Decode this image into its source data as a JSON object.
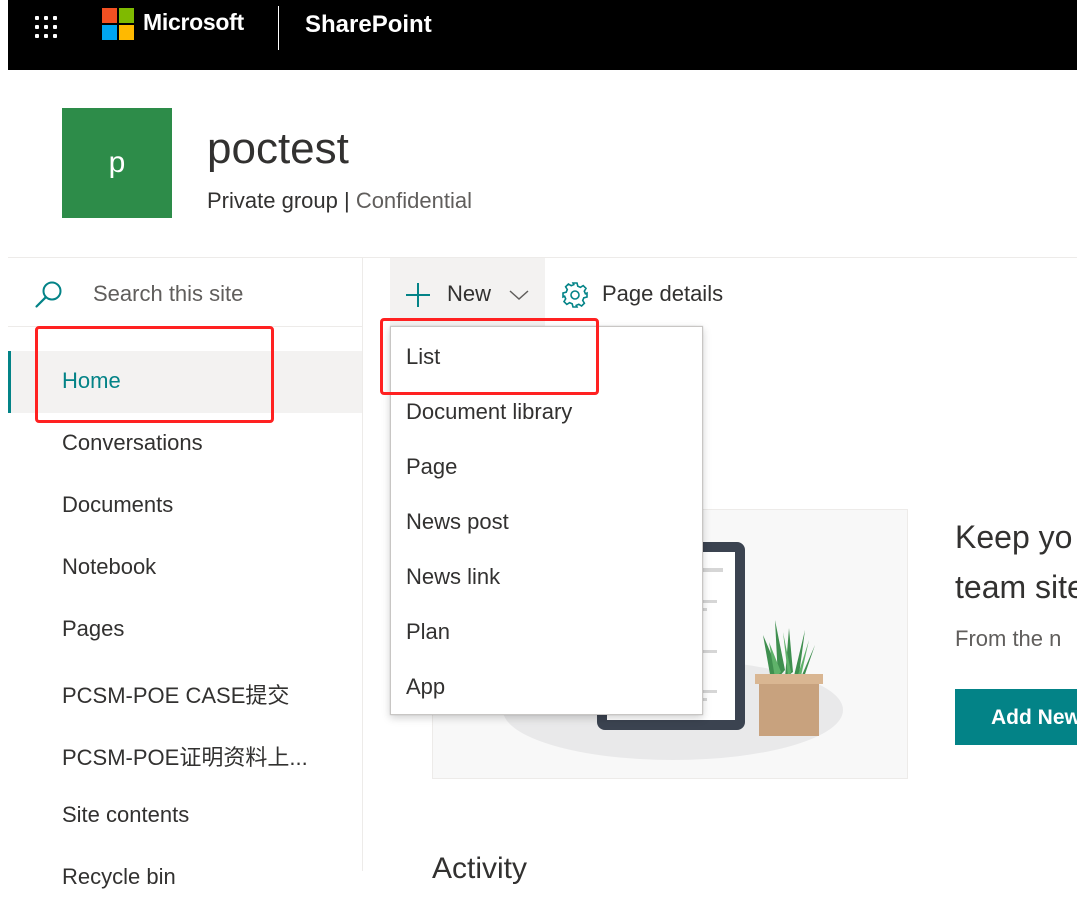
{
  "suite_bar": {
    "brand": "Microsoft",
    "app_name": "SharePoint",
    "colors": {
      "background": "#000000",
      "logo": [
        "#f25022",
        "#7fba00",
        "#00a4ef",
        "#ffb900"
      ]
    }
  },
  "site": {
    "logo_letter": "p",
    "title": "poctest",
    "group_type": "Private group",
    "separator": " | ",
    "classification": "Confidential",
    "logo_color": "#2d8c49"
  },
  "search": {
    "placeholder": "Search this site"
  },
  "nav": {
    "accent_color": "#038387",
    "items": [
      {
        "label": "Home",
        "active": true
      },
      {
        "label": "Conversations"
      },
      {
        "label": "Documents"
      },
      {
        "label": "Notebook"
      },
      {
        "label": "Pages"
      },
      {
        "label": "PCSM-POE CASE提交"
      },
      {
        "label": "PCSM-POE证明资料上..."
      },
      {
        "label": "Site contents"
      },
      {
        "label": "Recycle bin"
      }
    ]
  },
  "command_bar": {
    "new_label": "New",
    "page_details_label": "Page details"
  },
  "new_menu": {
    "items": [
      {
        "label": "List"
      },
      {
        "label": "Document library"
      },
      {
        "label": "Page"
      },
      {
        "label": "News post"
      },
      {
        "label": "News link"
      },
      {
        "label": "Plan"
      },
      {
        "label": "App"
      }
    ]
  },
  "welcome": {
    "heading_line1": "Keep yo",
    "heading_line2": "team site",
    "body": "From the n",
    "button_label": "Add New"
  },
  "activity_heading": "Activity",
  "annotation_color": "#ff2121"
}
